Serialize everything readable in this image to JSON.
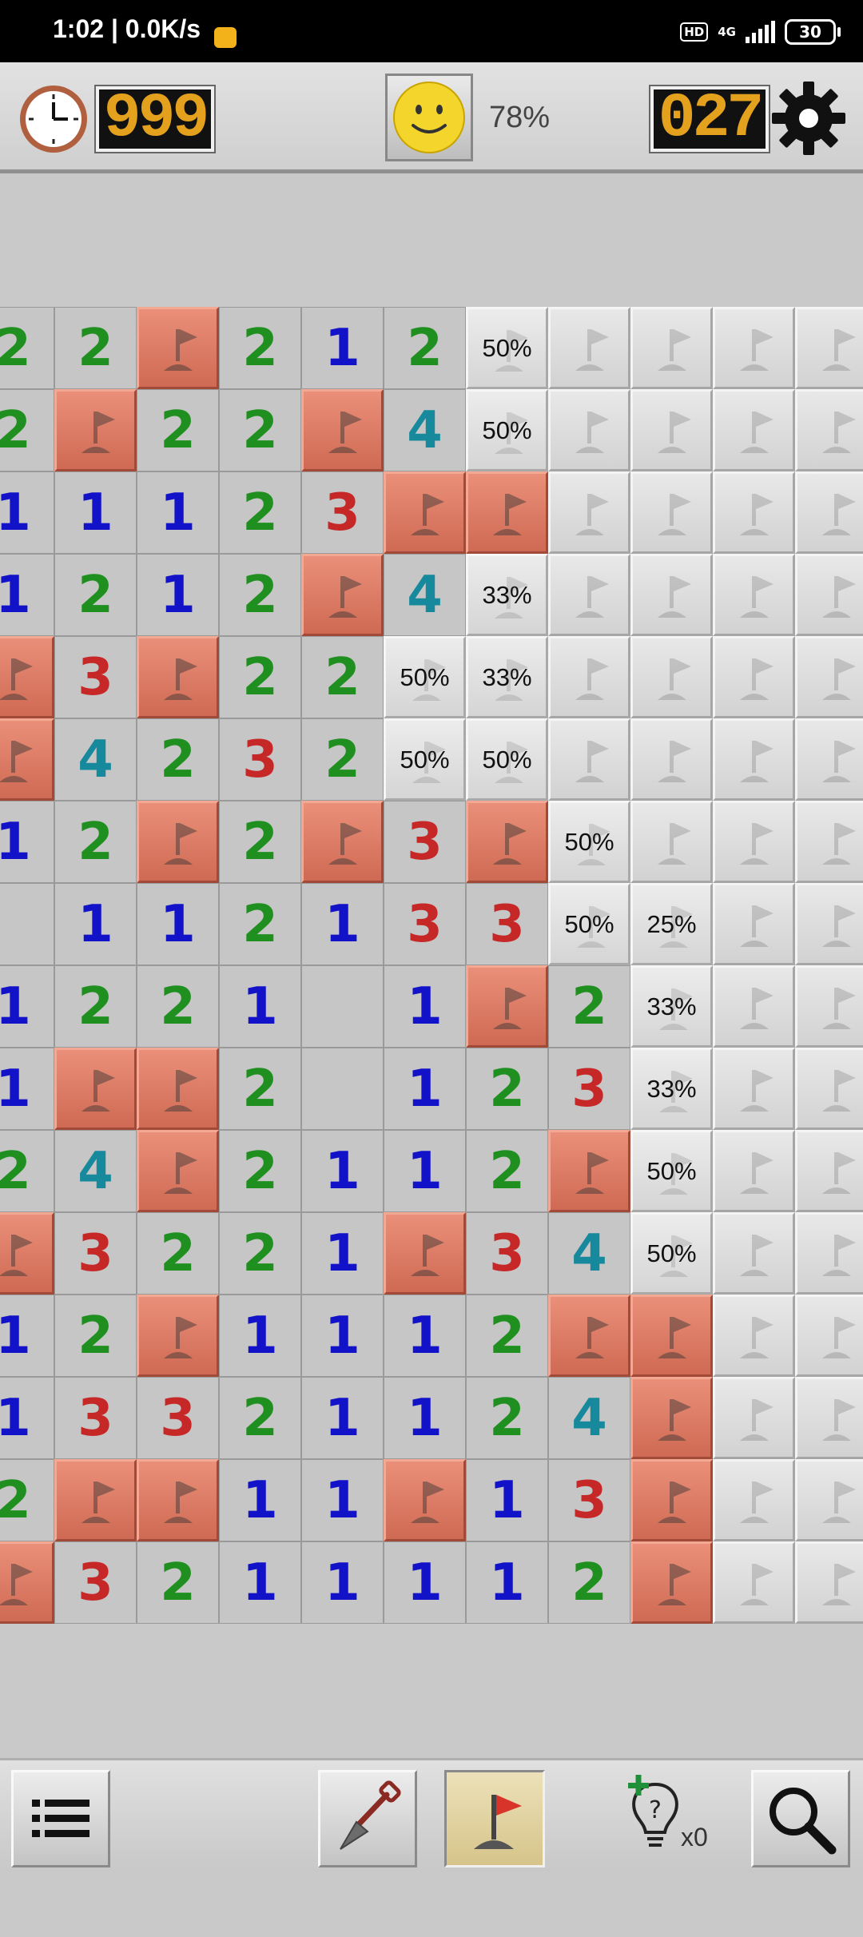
{
  "status_bar": {
    "time_speed": "1:02 | 0.0K/s",
    "hd_badge": "HD",
    "network": "4G",
    "battery": "30"
  },
  "header": {
    "timer": "999",
    "percent": "78%",
    "mines_left": "027",
    "icons": [
      "clock-icon",
      "smiley-face-icon",
      "gear-icon"
    ]
  },
  "board": {
    "legend": "number = revealed count, F = flag, U = unrevealed, E = empty, percent = mine probability",
    "number_colors": {
      "1": "#1212c8",
      "2": "#1f8f1f",
      "3": "#c62828",
      "4": "#168a9c"
    },
    "rows": [
      [
        "2",
        "2",
        "F",
        "2",
        "1",
        "2",
        "50%",
        "U",
        "U",
        "U",
        "U"
      ],
      [
        "2",
        "F",
        "2",
        "2",
        "F",
        "4",
        "50%",
        "U",
        "U",
        "U",
        "U"
      ],
      [
        "1",
        "1",
        "1",
        "2",
        "3",
        "F",
        "F",
        "U",
        "U",
        "U",
        "U"
      ],
      [
        "1",
        "2",
        "1",
        "2",
        "F",
        "4",
        "33%",
        "U",
        "U",
        "U",
        "U"
      ],
      [
        "F",
        "3",
        "F",
        "2",
        "2",
        "50%",
        "33%",
        "U",
        "U",
        "U",
        "U"
      ],
      [
        "F",
        "4",
        "2",
        "3",
        "2",
        "50%",
        "50%",
        "U",
        "U",
        "U",
        "U"
      ],
      [
        "1",
        "2",
        "F",
        "2",
        "F",
        "3",
        "F",
        "50%",
        "U",
        "U",
        "U"
      ],
      [
        "E",
        "1",
        "1",
        "2",
        "1",
        "3",
        "3",
        "50%",
        "25%",
        "U",
        "U"
      ],
      [
        "1",
        "2",
        "2",
        "1",
        "E",
        "1",
        "F",
        "2",
        "33%",
        "U",
        "U"
      ],
      [
        "1",
        "F",
        "F",
        "2",
        "E",
        "1",
        "2",
        "3",
        "33%",
        "U",
        "U"
      ],
      [
        "2",
        "4",
        "F",
        "2",
        "1",
        "1",
        "2",
        "F",
        "50%",
        "U",
        "U"
      ],
      [
        "F",
        "3",
        "2",
        "2",
        "1",
        "F",
        "3",
        "4",
        "50%",
        "U",
        "U"
      ],
      [
        "1",
        "2",
        "F",
        "1",
        "1",
        "1",
        "2",
        "F",
        "F",
        "U",
        "U"
      ],
      [
        "1",
        "3",
        "3",
        "2",
        "1",
        "1",
        "2",
        "4",
        "F",
        "U",
        "U"
      ],
      [
        "2",
        "F",
        "F",
        "1",
        "1",
        "F",
        "1",
        "3",
        "F",
        "U",
        "U"
      ],
      [
        "F",
        "3",
        "2",
        "1",
        "1",
        "1",
        "1",
        "2",
        "F",
        "U",
        "U"
      ]
    ]
  },
  "toolbar": {
    "hint_count": "x0",
    "icons": [
      "menu-list-icon",
      "shovel-icon",
      "flag-icon",
      "hint-bulb-icon",
      "magnifier-icon"
    ]
  }
}
